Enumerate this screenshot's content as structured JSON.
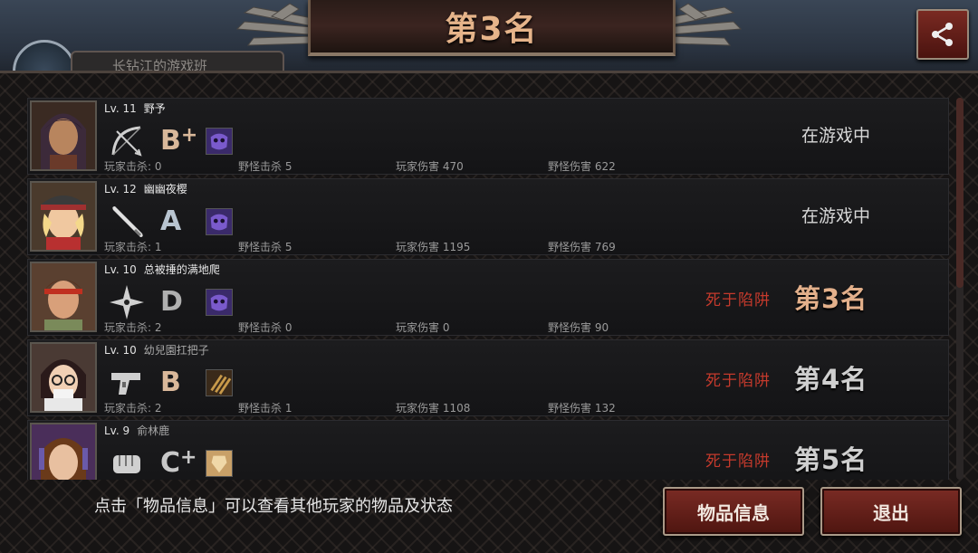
{
  "title": "第3名",
  "faint_tab_text": "长钻江的游戏班",
  "players": [
    {
      "level": "Lv. 11",
      "name": "野予",
      "weapon_icon": "bow-icon",
      "grade": "B",
      "grade_plus": "+",
      "item_icon": "purple-mask-icon",
      "stats": [
        "玩家击杀: 0",
        "野怪击杀 5",
        "玩家伤害 470",
        "野怪伤害 622"
      ],
      "status": "在游戏中",
      "death": "",
      "rank": ""
    },
    {
      "level": "Lv. 12",
      "name": "幽幽夜樱",
      "weapon_icon": "bat-icon",
      "grade": "A",
      "grade_plus": "",
      "item_icon": "purple-mask-icon",
      "stats": [
        "玩家击杀: 1",
        "野怪击杀 5",
        "玩家伤害 1195",
        "野怪伤害 769"
      ],
      "status": "在游戏中",
      "death": "",
      "rank": ""
    },
    {
      "level": "Lv. 10",
      "name": "总被捶的满地爬",
      "weapon_icon": "shuriken-icon",
      "grade": "D",
      "grade_plus": "",
      "item_icon": "purple-mask-icon",
      "stats": [
        "玩家击杀: 2",
        "野怪击杀 0",
        "玩家伤害 0",
        "野怪伤害 90"
      ],
      "status": "",
      "death": "死于陷阱",
      "rank": "第3名"
    },
    {
      "level": "Lv. 10",
      "name": "幼兒園扛把子",
      "weapon_icon": "pistol-icon",
      "grade": "B",
      "grade_plus": "",
      "item_icon": "bullets-icon",
      "stats": [
        "玩家击杀: 2",
        "野怪击杀 1",
        "玩家伤害 1108",
        "野怪伤害 132"
      ],
      "status": "",
      "death": "死于陷阱",
      "rank": "第4名"
    },
    {
      "level": "Lv. 9",
      "name": "俞林鹿",
      "weapon_icon": "fist-icon",
      "grade": "C",
      "grade_plus": "+",
      "item_icon": "gold-item-icon",
      "stats": [
        "",
        "",
        "",
        ""
      ],
      "status": "",
      "death": "死于陷阱",
      "rank": "第5名"
    }
  ],
  "hint": "点击「物品信息」可以查看其他玩家的物品及状态",
  "buttons": {
    "items": "物品信息",
    "exit": "退出"
  },
  "colors": {
    "accent_red": "#c53a2c",
    "rank_gold": "#e3b08b",
    "button_red": "#7a2b24"
  }
}
